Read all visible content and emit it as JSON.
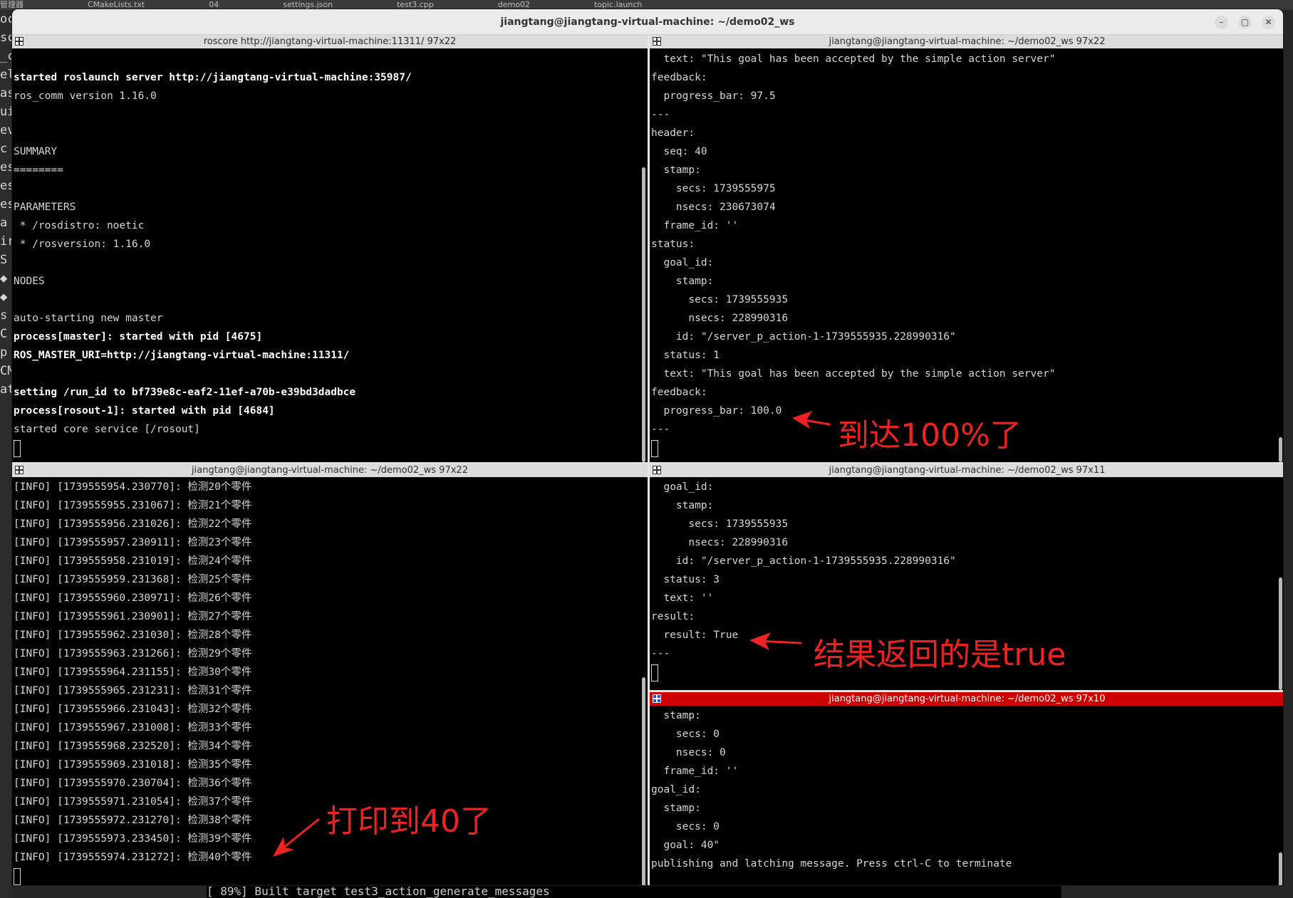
{
  "background": {
    "top_tabs": [
      "管理器",
      "CMakeLists.txt",
      "04",
      "settings.json",
      "test3.cpp",
      "demo02",
      "topic.launch"
    ],
    "left_fragments": [
      "oc",
      "sc",
      "_c",
      "el",
      "as",
      "uil",
      "ev",
      "c",
      "es",
      "es",
      "es",
      "a",
      "ir",
      "S",
      "◆",
      "◆",
      "s",
      "C",
      "p",
      "CM",
      "at"
    ],
    "bottom_text": "[ 89%] Built target test3_action_generate_messages"
  },
  "window": {
    "title": "jiangtang@jiangtang-virtual-machine: ~/demo02_ws",
    "controls": {
      "minimize": "–",
      "maximize": "▢",
      "close": "✕"
    }
  },
  "panes": {
    "roscore": {
      "title": "roscore http://jiangtang-virtual-machine:11311/ 97x22",
      "lines": [
        {
          "text": "",
          "bold": false
        },
        {
          "text": "started roslaunch server http://jiangtang-virtual-machine:35987/",
          "bold": true
        },
        {
          "text": "ros_comm version 1.16.0",
          "bold": false
        },
        {
          "text": "",
          "bold": false
        },
        {
          "text": "",
          "bold": false
        },
        {
          "text": "SUMMARY",
          "bold": false
        },
        {
          "text": "========",
          "bold": false
        },
        {
          "text": "",
          "bold": false
        },
        {
          "text": "PARAMETERS",
          "bold": false
        },
        {
          "text": " * /rosdistro: noetic",
          "bold": false
        },
        {
          "text": " * /rosversion: 1.16.0",
          "bold": false
        },
        {
          "text": "",
          "bold": false
        },
        {
          "text": "NODES",
          "bold": false
        },
        {
          "text": "",
          "bold": false
        },
        {
          "text": "auto-starting new master",
          "bold": false
        },
        {
          "text": "process[master]: started with pid [4675]",
          "bold": true
        },
        {
          "text": "ROS_MASTER_URI=http://jiangtang-virtual-machine:11311/",
          "bold": true
        },
        {
          "text": "",
          "bold": false
        },
        {
          "text": "setting /run_id to bf739e8c-eaf2-11ef-a70b-e39bd3dadbce",
          "bold": true
        },
        {
          "text": "process[rosout-1]: started with pid [4684]",
          "bold": true
        },
        {
          "text": "started core service [/rosout]",
          "bold": false
        }
      ]
    },
    "feedback": {
      "title": "jiangtang@jiangtang-virtual-machine: ~/demo02_ws 97x22",
      "lines": [
        "  text: \"This goal has been accepted by the simple action server\"",
        "feedback:",
        "  progress_bar: 97.5",
        "---",
        "header:",
        "  seq: 40",
        "  stamp:",
        "    secs: 1739555975",
        "    nsecs: 230673074",
        "  frame_id: ''",
        "status:",
        "  goal_id:",
        "    stamp:",
        "      secs: 1739555935",
        "      nsecs: 228990316",
        "    id: \"/server_p_action-1-1739555935.228990316\"",
        "  status: 1",
        "  text: \"This goal has been accepted by the simple action server\"",
        "feedback:",
        "  progress_bar: 100.0",
        "---"
      ]
    },
    "server_log": {
      "title": "jiangtang@jiangtang-virtual-machine: ~/demo02_ws 97x22",
      "lines": [
        "[INFO] [1739555954.230770]: 检测20个零件",
        "[INFO] [1739555955.231067]: 检测21个零件",
        "[INFO] [1739555956.231026]: 检测22个零件",
        "[INFO] [1739555957.230911]: 检测23个零件",
        "[INFO] [1739555958.231019]: 检测24个零件",
        "[INFO] [1739555959.231368]: 检测25个零件",
        "[INFO] [1739555960.230971]: 检测26个零件",
        "[INFO] [1739555961.230901]: 检测27个零件",
        "[INFO] [1739555962.231030]: 检测28个零件",
        "[INFO] [1739555963.231266]: 检测29个零件",
        "[INFO] [1739555964.231155]: 检测30个零件",
        "[INFO] [1739555965.231231]: 检测31个零件",
        "[INFO] [1739555966.231043]: 检测32个零件",
        "[INFO] [1739555967.231008]: 检测33个零件",
        "[INFO] [1739555968.232520]: 检测34个零件",
        "[INFO] [1739555969.231018]: 检测35个零件",
        "[INFO] [1739555970.230704]: 检测36个零件",
        "[INFO] [1739555971.231054]: 检测37个零件",
        "[INFO] [1739555972.231270]: 检测38个零件",
        "[INFO] [1739555973.233450]: 检测39个零件",
        "[INFO] [1739555974.231272]: 检测40个零件"
      ]
    },
    "result": {
      "title": "jiangtang@jiangtang-virtual-machine: ~/demo02_ws 97x11",
      "lines": [
        "  goal_id:",
        "    stamp:",
        "      secs: 1739555935",
        "      nsecs: 228990316",
        "    id: \"/server_p_action-1-1739555935.228990316\"",
        "  status: 3",
        "  text: ''",
        "result:",
        "  result: True",
        "---"
      ]
    },
    "goal_pub": {
      "title": "jiangtang@jiangtang-virtual-machine: ~/demo02_ws 97x10",
      "active": true,
      "lines": [
        "  stamp:",
        "    secs: 0",
        "    nsecs: 0",
        "  frame_id: ''",
        "goal_id:",
        "  stamp:",
        "    secs: 0",
        "  goal: 40\"",
        "publishing and latching message. Press ctrl-C to terminate"
      ]
    }
  },
  "annotations": {
    "reach_100": "到达100%了",
    "result_true": "结果返回的是true",
    "printed_40": "打印到40了",
    "color": "#ee2222"
  }
}
